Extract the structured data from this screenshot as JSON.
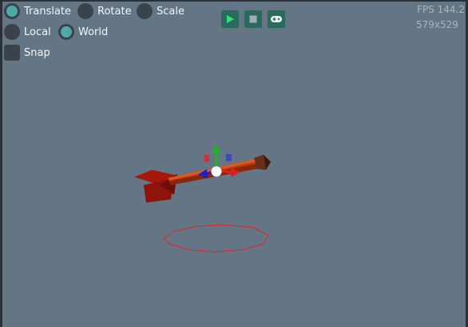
{
  "toolbar": {
    "translate_label": "Translate",
    "rotate_label": "Rotate",
    "scale_label": "Scale",
    "local_label": "Local",
    "world_label": "World",
    "snap_label": "Snap",
    "selected_mode": "Translate",
    "selected_space": "World",
    "snap_enabled": false
  },
  "playback": {
    "play_icon": "play-icon",
    "stop_icon": "stop-icon",
    "gamepad_icon": "gamepad-icon",
    "accent": "#2a6b5e"
  },
  "stats": {
    "fps": "FPS 144.2",
    "resolution": "579x529"
  },
  "viewport": {
    "background": "#647585",
    "object": "rocket",
    "gizmo_colors": {
      "x": "#e0201c",
      "y": "#22b322",
      "z": "#2020c0"
    },
    "shadow_ring_color": "#e8202a"
  }
}
